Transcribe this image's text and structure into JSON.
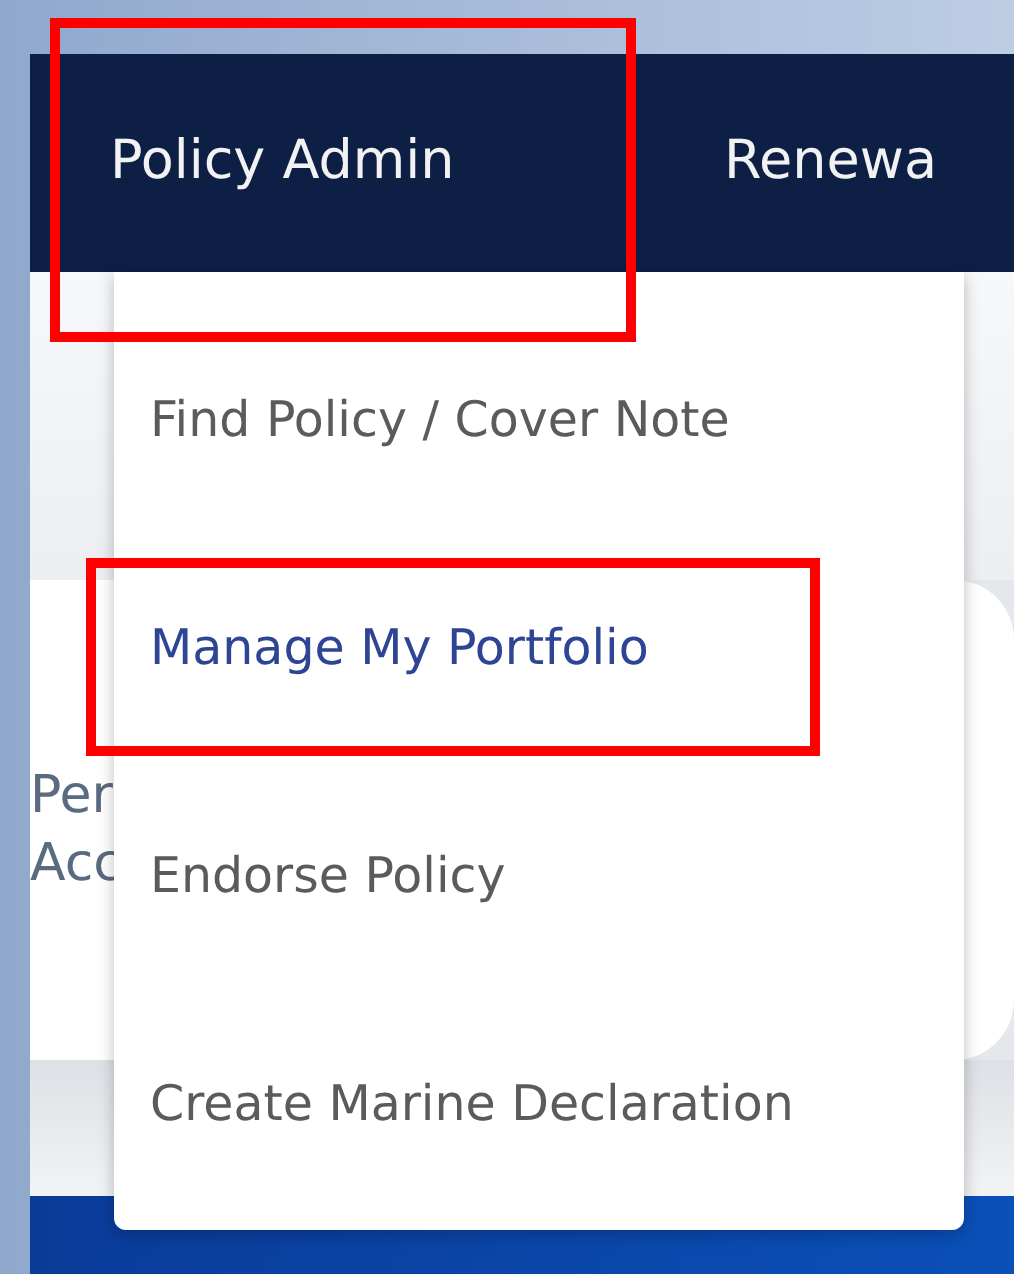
{
  "nav": [
    {
      "label": "Policy Admin",
      "annotated": true
    },
    {
      "label": "Renewa",
      "annotated": false
    }
  ],
  "dropdown": [
    {
      "label": "Find Policy / Cover Note",
      "selected": false,
      "annotated": false
    },
    {
      "label": "Manage My Portfolio",
      "selected": true,
      "annotated": true
    },
    {
      "label": "Endorse Policy",
      "selected": false,
      "annotated": false
    },
    {
      "label": "Create Marine Declaration",
      "selected": false,
      "annotated": false
    }
  ],
  "card": {
    "lines": [
      "Per",
      "Acc"
    ]
  }
}
